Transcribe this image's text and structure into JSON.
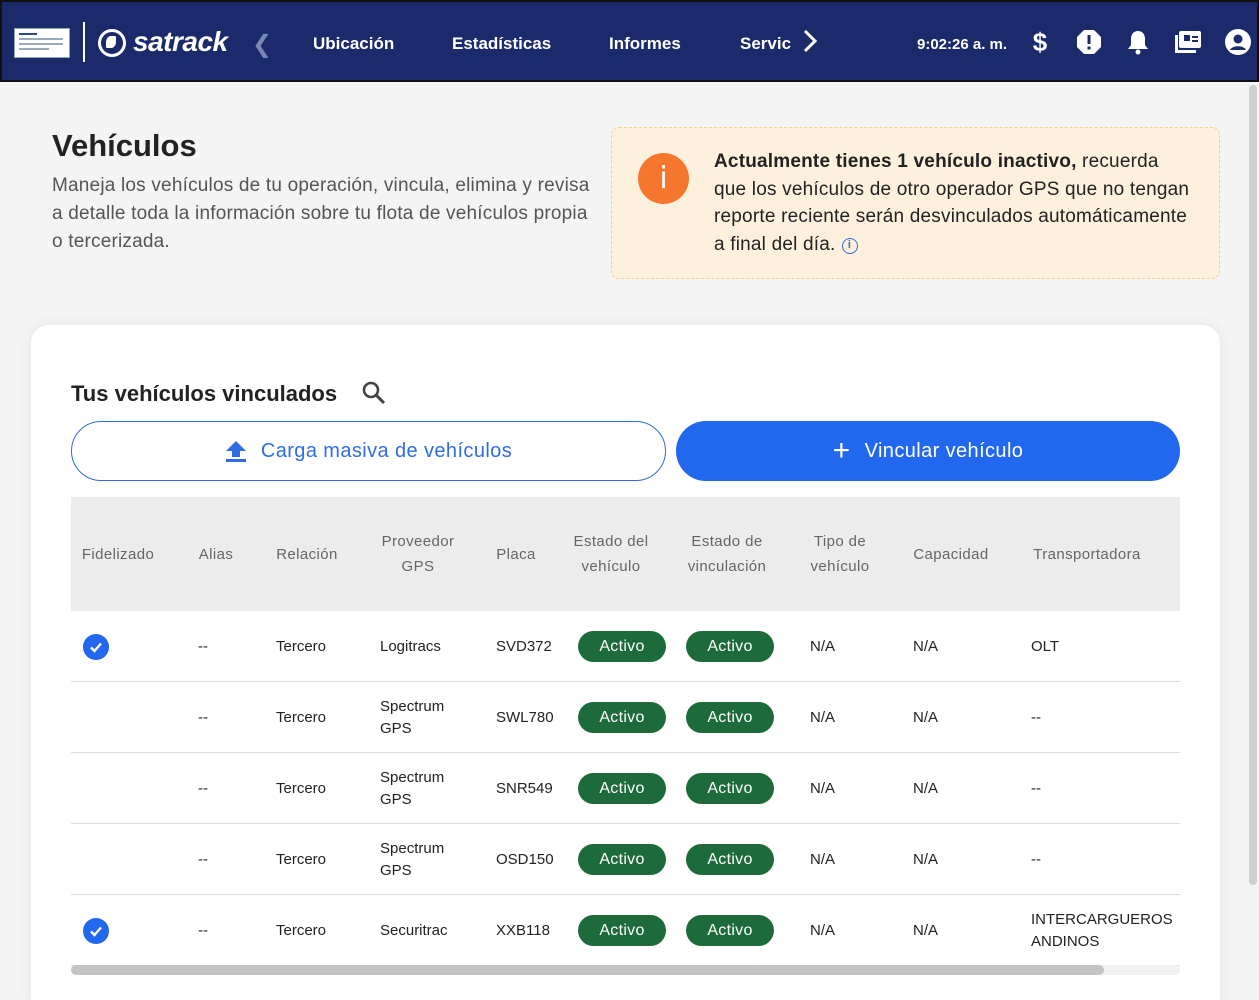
{
  "topbar": {
    "brand": "satrack",
    "nav": [
      "Ubicación",
      "Estadísticas",
      "Informes",
      "Servic"
    ],
    "clock": "9:02:26 a. m.",
    "icons": [
      "dollar-icon",
      "alert-icon",
      "bell-icon",
      "monitor-icon",
      "account-icon"
    ]
  },
  "header": {
    "title": "Vehículos",
    "description": "Maneja los vehículos de tu operación, vincula, elimina y revisa a detalle toda la información sobre tu flota de vehículos propia o tercerizada."
  },
  "alert": {
    "bold": "Actualmente tienes 1 vehículo inactivo,",
    "text": " recuerda que los vehículos de otro operador GPS que no tengan reporte reciente serán desvinculados automáticamente a final del día.",
    "icon_glyph": "i",
    "info_glyph": "i",
    "accent": "#f7762d"
  },
  "card": {
    "title": "Tus vehículos vinculados",
    "bulk_button": "Carga masiva de vehículos",
    "link_button": "Vincular vehículo",
    "link_button_icon": "+"
  },
  "table": {
    "columns": [
      "Fidelizado",
      "Alias",
      "Relación",
      "Proveedor GPS",
      "Placa",
      "Estado del vehículo",
      "Estado de vinculación",
      "Tipo de vehículo",
      "Capacidad",
      "Transportadora"
    ],
    "rows": [
      {
        "fidelizado": true,
        "alias": "--",
        "relacion": "Tercero",
        "proveedor": "Logitracs",
        "placa": "SVD372",
        "estado": "Activo",
        "vinculacion": "Activo",
        "tipo": "N/A",
        "capacidad": "N/A",
        "transportadora": "OLT"
      },
      {
        "fidelizado": false,
        "alias": "--",
        "relacion": "Tercero",
        "proveedor": "Spectrum GPS",
        "placa": "SWL780",
        "estado": "Activo",
        "vinculacion": "Activo",
        "tipo": "N/A",
        "capacidad": "N/A",
        "transportadora": "--"
      },
      {
        "fidelizado": false,
        "alias": "--",
        "relacion": "Tercero",
        "proveedor": "Spectrum GPS",
        "placa": "SNR549",
        "estado": "Activo",
        "vinculacion": "Activo",
        "tipo": "N/A",
        "capacidad": "N/A",
        "transportadora": "--"
      },
      {
        "fidelizado": false,
        "alias": "--",
        "relacion": "Tercero",
        "proveedor": "Spectrum GPS",
        "placa": "OSD150",
        "estado": "Activo",
        "vinculacion": "Activo",
        "tipo": "N/A",
        "capacidad": "N/A",
        "transportadora": "--"
      },
      {
        "fidelizado": true,
        "alias": "--",
        "relacion": "Tercero",
        "proveedor": "Securitrac",
        "placa": "XXB118",
        "estado": "Activo",
        "vinculacion": "Activo",
        "tipo": "N/A",
        "capacidad": "N/A",
        "transportadora": "INTERCARGUEROS ANDINOS"
      }
    ]
  },
  "colors": {
    "navbar": "#1b2a6b",
    "primary": "#2268ee",
    "status_active": "#1d6b3b",
    "alert_bg": "#fdf1dd"
  }
}
